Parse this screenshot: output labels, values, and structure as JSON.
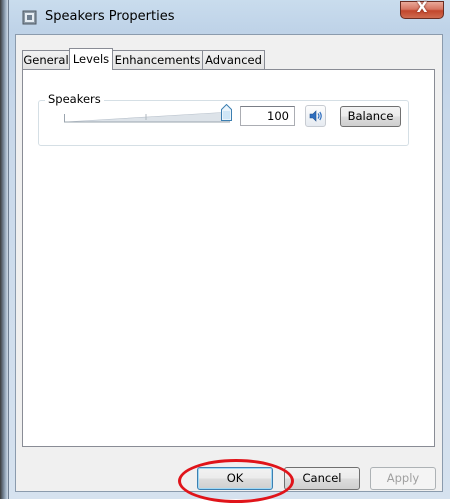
{
  "window": {
    "title": "Speakers Properties",
    "close_glyph": "X"
  },
  "tabs": [
    {
      "label": "General",
      "active": false
    },
    {
      "label": "Levels",
      "active": true
    },
    {
      "label": "Enhancements",
      "active": false
    },
    {
      "label": "Advanced",
      "active": false
    }
  ],
  "levels": {
    "group_label": "Speakers",
    "volume_value": "100",
    "volume_level": 1.0,
    "mute_icon": "speaker-icon",
    "balance_label": "Balance"
  },
  "footer": {
    "ok_label": "OK",
    "cancel_label": "Cancel",
    "apply_label": "Apply",
    "apply_enabled": false
  },
  "annotation": {
    "highlight_color": "#e0141a",
    "highlighted": "ok-button"
  }
}
